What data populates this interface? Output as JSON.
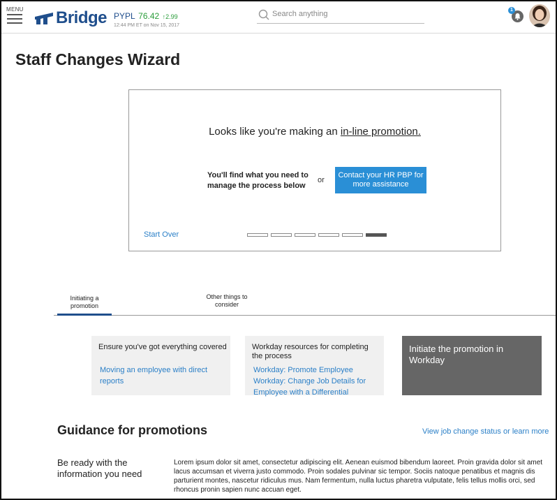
{
  "header": {
    "menu_label": "MENU",
    "logo_text": "Bridge",
    "ticker": {
      "symbol": "PYPL",
      "price": "76.42",
      "change": "2.99",
      "change_arrow": "↑",
      "timestamp": "12:44 PM ET on Nov 15, 2017"
    },
    "search_placeholder": "Search anything",
    "notification_count": "1"
  },
  "page_title": "Staff Changes Wizard",
  "wizard": {
    "headline_prefix": "Looks like you're making an ",
    "headline_link": "in-line promotion.",
    "left_text": "You'll find what you need to manage the process below",
    "or_text": "or",
    "contact_button": "Contact your HR PBP for more assistance",
    "start_over": "Start Over",
    "steps_total": 6,
    "steps_active": 6
  },
  "tabs": [
    {
      "label": "Initiating a promotion",
      "active": true
    },
    {
      "label": "Other things to consider",
      "active": false
    }
  ],
  "cards": {
    "card1": {
      "title": "Ensure you've got everything covered",
      "links": [
        "Moving an employee with direct reports"
      ]
    },
    "card2": {
      "title": "Workday resources for completing the process",
      "links": [
        "Workday: Promote Employee",
        "Workday: Change Job Details for Employee with a Differential"
      ]
    },
    "card3": {
      "label": "Initiate the promotion in Workday"
    }
  },
  "guidance": {
    "title": "Guidance for promotions",
    "view_link": "View job change status or learn more",
    "ready_label": "Be ready with the information you need",
    "body": "Lorem ipsum dolor sit amet, consectetur adipiscing elit. Aenean euismod bibendum laoreet. Proin gravida dolor sit amet lacus accumsan et viverra justo commodo. Proin sodales pulvinar sic tempor. Sociis natoque penatibus et magnis dis parturient montes, nascetur ridiculus mus. Nam fermentum, nulla luctus pharetra vulputate, felis tellus mollis orci, sed rhoncus pronin sapien nunc accuan eget."
  },
  "colors": {
    "brand": "#1f4e8c",
    "link": "#2a7fc7",
    "button": "#2a8fd6",
    "positive": "#2a9d3a",
    "dark_card": "#666666"
  }
}
